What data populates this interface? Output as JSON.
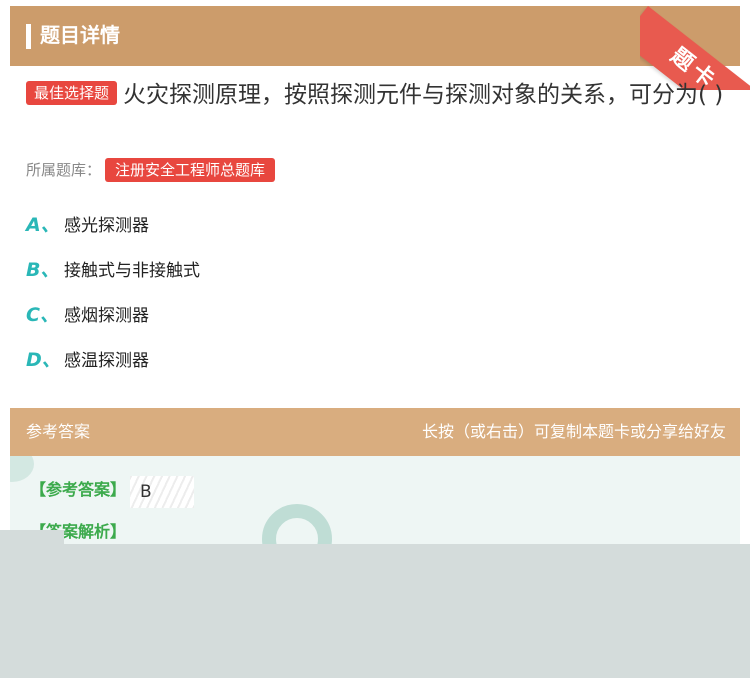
{
  "header": {
    "title": "题目详情",
    "corner_label": "题卡"
  },
  "question": {
    "tag": "最佳选择题",
    "text": "火灾探测原理，按照探测元件与探测对象的关系，可分为( )"
  },
  "bank": {
    "label": "所属题库：",
    "name": "注册安全工程师总题库"
  },
  "options": [
    {
      "letter": "A、",
      "text": "感光探测器"
    },
    {
      "letter": "B、",
      "text": "接触式与非接触式"
    },
    {
      "letter": "C、",
      "text": "感烟探测器"
    },
    {
      "letter": "D、",
      "text": "感温探测器"
    }
  ],
  "answer_bar": {
    "label": "参考答案",
    "hint": "长按（或右击）可复制本题卡或分享给好友"
  },
  "answer": {
    "label": "【参考答案】",
    "value": "B"
  },
  "analysis": {
    "label": "【答案解析】"
  },
  "colors": {
    "header": "#cc9c6b",
    "accent_red": "#e8473f",
    "option_letter": "#2ab7b7",
    "answer_green": "#3caa4c"
  }
}
